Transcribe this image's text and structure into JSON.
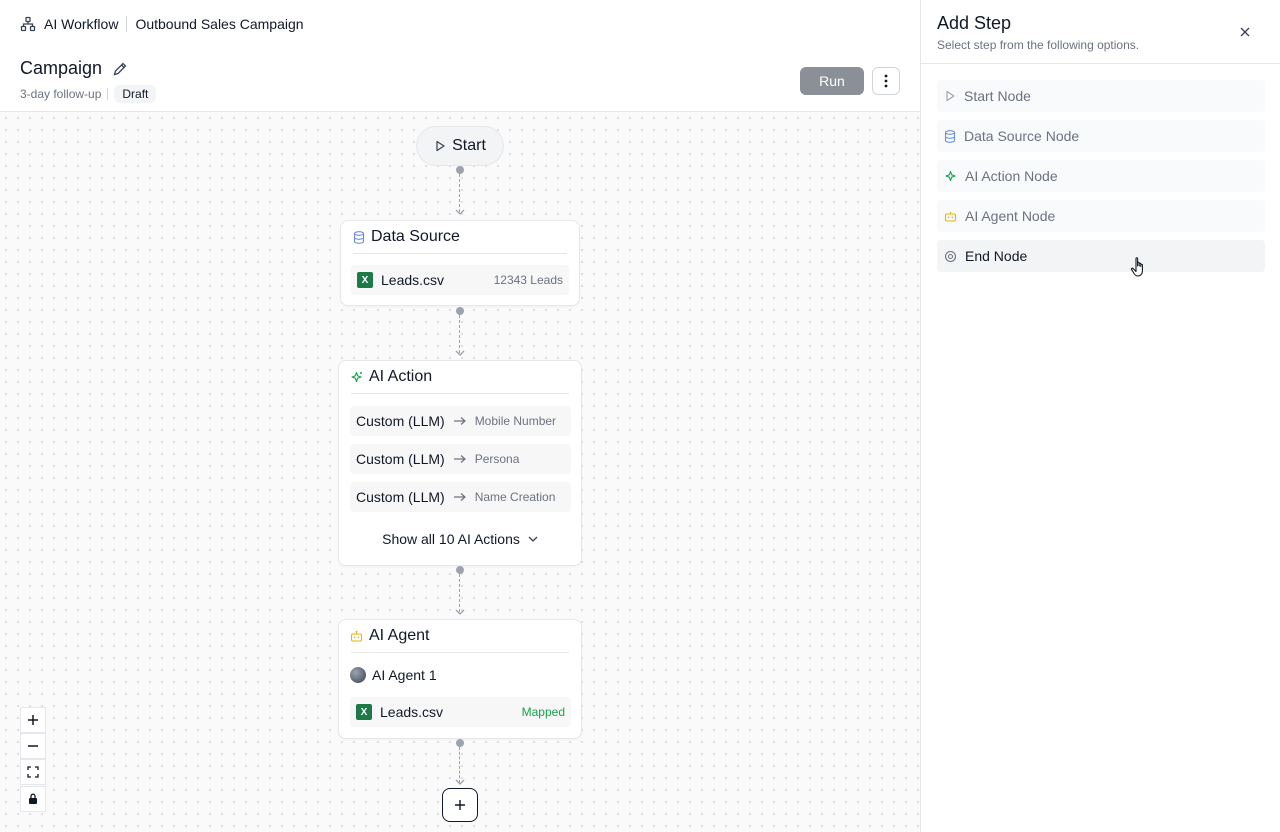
{
  "breadcrumb": {
    "app": "AI Workflow",
    "campaign": "Outbound Sales Campaign"
  },
  "header": {
    "title": "Campaign",
    "subtitle": "3-day follow-up",
    "status_badge": "Draft",
    "run_label": "Run"
  },
  "canvas": {
    "start_label": "Start",
    "data_source": {
      "title": "Data Source",
      "file": "Leads.csv",
      "count": "12343 Leads"
    },
    "ai_action": {
      "title": "AI Action",
      "actions": [
        {
          "name": "Custom (LLM)",
          "target": "Mobile Number"
        },
        {
          "name": "Custom (LLM)",
          "target": "Persona"
        },
        {
          "name": "Custom (LLM)",
          "target": "Name Creation"
        }
      ],
      "show_all": "Show all 10 AI Actions"
    },
    "ai_agent": {
      "title": "AI Agent",
      "agent": "AI Agent 1",
      "file": "Leads.csv",
      "mapped": "Mapped"
    }
  },
  "panel": {
    "title": "Add Step",
    "subtitle": "Select step from the following options.",
    "options": [
      {
        "label": "Start Node",
        "icon": "play-icon"
      },
      {
        "label": "Data Source Node",
        "icon": "database-icon"
      },
      {
        "label": "AI Action Node",
        "icon": "sparkle-icon"
      },
      {
        "label": "AI Agent Node",
        "icon": "bot-icon"
      },
      {
        "label": "End Node",
        "icon": "stop-circle-icon"
      }
    ]
  },
  "colors": {
    "accent_green": "#16a34a",
    "excel_green": "#1d7a46",
    "agent_yellow": "#eab308",
    "datasource_blue": "#6b8fd6",
    "run_button": "#8b8f97"
  }
}
